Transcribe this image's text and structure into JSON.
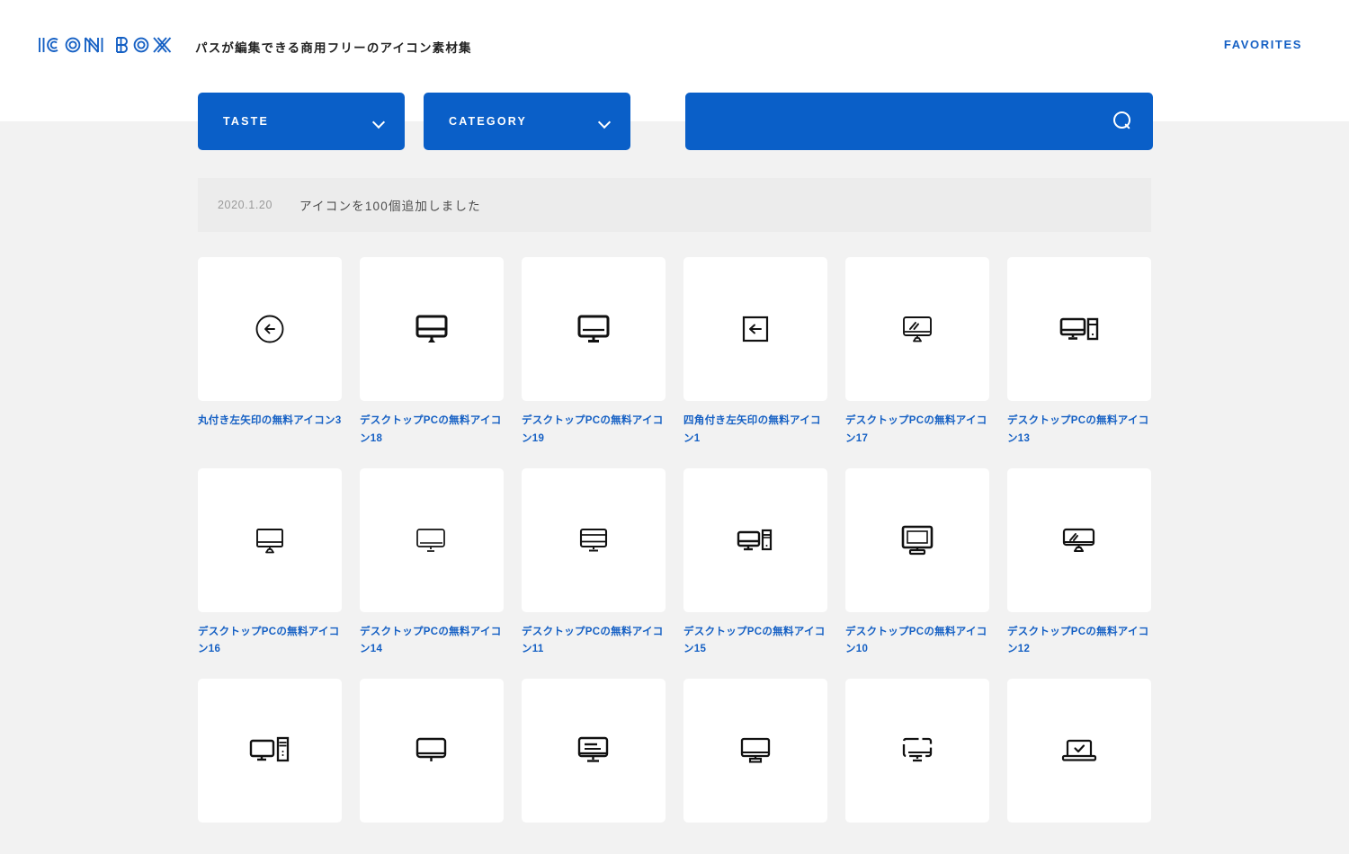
{
  "site": {
    "logo_text": "ICON BOX",
    "tagline": "パスが編集できる商用フリーのアイコン素材集",
    "accent_blue": "#0a5fc8",
    "link_blue": "#1560c4",
    "page_background": "#f2f2f2",
    "notice_background": "#ececec"
  },
  "header": {
    "favorites_label": "FAVORITES"
  },
  "filters": {
    "taste": {
      "label": "TASTE",
      "icon": "chevron-down-icon"
    },
    "category": {
      "label": "CATEGORY",
      "icon": "chevron-down-icon"
    },
    "search": {
      "value": "",
      "placeholder": "",
      "icon": "search-icon"
    }
  },
  "notice": {
    "date": "2020.1.20",
    "text": "アイコンを100個追加しました"
  },
  "grid": {
    "items": [
      {
        "label": "丸付き左矢印の無料アイコン3",
        "icon": "circle-left-arrow-icon"
      },
      {
        "label": "デスクトップPCの無料アイコン18",
        "icon": "desktop-pc-solid-icon"
      },
      {
        "label": "デスクトップPCの無料アイコン19",
        "icon": "desktop-pc-line-icon"
      },
      {
        "label": "四角付き左矢印の無料アイコン1",
        "icon": "square-left-arrow-icon"
      },
      {
        "label": "デスクトップPCの無料アイコン17",
        "icon": "desktop-pc-shine-icon"
      },
      {
        "label": "デスクトップPCの無料アイコン13",
        "icon": "desktop-pc-tower-icon"
      },
      {
        "label": "デスクトップPCの無料アイコン16",
        "icon": "desktop-pc-outline-icon"
      },
      {
        "label": "デスクトップPCの無料アイコン14",
        "icon": "desktop-pc-thin-icon"
      },
      {
        "label": "デスクトップPCの無料アイコン11",
        "icon": "desktop-pc-striped-icon"
      },
      {
        "label": "デスクトップPCの無料アイコン15",
        "icon": "desktop-pc-tower-small-icon"
      },
      {
        "label": "デスクトップPCの無料アイコン10",
        "icon": "desktop-pc-thick-icon"
      },
      {
        "label": "デスクトップPCの無料アイコン12",
        "icon": "desktop-pc-shine-wide-icon"
      },
      {
        "label": "",
        "icon": "desktop-pc-tower-tall-icon"
      },
      {
        "label": "",
        "icon": "desktop-pc-round-icon"
      },
      {
        "label": "",
        "icon": "desktop-pc-text-icon"
      },
      {
        "label": "",
        "icon": "desktop-pc-plain-icon"
      },
      {
        "label": "",
        "icon": "desktop-pc-dashed-icon"
      },
      {
        "label": "",
        "icon": "laptop-check-icon"
      }
    ]
  }
}
